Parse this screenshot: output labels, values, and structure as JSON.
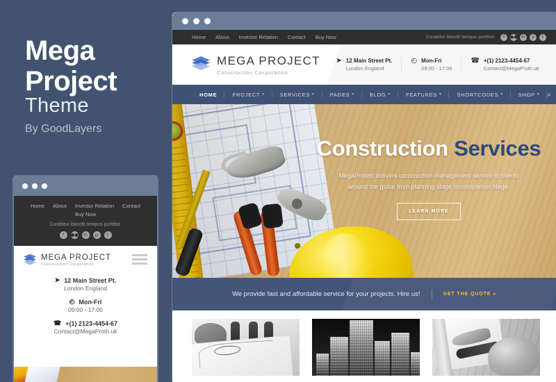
{
  "promo": {
    "title_line1": "Mega",
    "title_line2": "Project",
    "subtitle": "Theme",
    "author": "By GoodLayers"
  },
  "colors": {
    "background": "#41536f",
    "nav_bar": "#3f5175",
    "top_bar": "#2e2e2e",
    "hero_accent": "#2c4a7c",
    "cta_accent": "#f5c51b",
    "title_bar": "#6b7d97"
  },
  "browser": {
    "dots": [
      "dot-1",
      "dot-2",
      "dot-3"
    ]
  },
  "topbar": {
    "links": [
      "Home",
      "About",
      "Investor Relation",
      "Contact",
      "Buy Now"
    ],
    "tagline": "Curabitur blandit tempus porttitor.",
    "social": [
      {
        "name": "facebook-icon",
        "glyph": "f"
      },
      {
        "name": "flickr-icon",
        "glyph": "●●"
      },
      {
        "name": "linkedin-icon",
        "glyph": "in"
      },
      {
        "name": "pinterest-icon",
        "glyph": "p"
      },
      {
        "name": "twitter-icon",
        "glyph": "t"
      }
    ]
  },
  "header": {
    "logo_title": "MEGA PROJECT",
    "logo_subtitle": "Construction Corporation",
    "contacts": [
      {
        "icon": "location-icon",
        "glyph": "➤",
        "line1": "12 Main Street Pt.",
        "line2": "London England"
      },
      {
        "icon": "clock-icon",
        "glyph": "◴",
        "line1": "Mon-Fri",
        "line2": "09:00 - 17:00"
      },
      {
        "icon": "phone-icon",
        "glyph": "☎",
        "line1": "+(1) 2123-4454-67",
        "line2": "Contact@MegaProth.uk"
      }
    ]
  },
  "nav": {
    "items": [
      {
        "label": "HOME",
        "caret": "",
        "active": true
      },
      {
        "label": "PROJECT",
        "caret": "▾",
        "active": false
      },
      {
        "label": "SERVICES",
        "caret": "▾",
        "active": false
      },
      {
        "label": "PAGES",
        "caret": "▾",
        "active": false
      },
      {
        "label": "BLOG",
        "caret": "▾",
        "active": false
      },
      {
        "label": "FEATURES",
        "caret": "▾",
        "active": false
      },
      {
        "label": "SHORTCODES",
        "caret": "▾",
        "active": false
      },
      {
        "label": "SHOP",
        "caret": "▾",
        "active": false
      }
    ],
    "search_glyph": "⌕"
  },
  "hero": {
    "title_main": "Construction ",
    "title_accent": "Services",
    "description": "MegaProject delivers construction management service to clients around the globe from planning stage to completion stage.",
    "button_label": "LEARN MORE"
  },
  "cta": {
    "text": "We provide fast and affordable service for your projects. Hire us!",
    "button_label": "GET THE QUOTE  »"
  },
  "thumbnails": [
    {
      "name": "blueprint-meeting-photo",
      "alt": "Blueprints with glasses and people"
    },
    {
      "name": "city-skyline-photo",
      "alt": "Skyscrapers at night"
    },
    {
      "name": "tools-hardhat-photo",
      "alt": "Tools and hard hat on wood"
    }
  ],
  "mobile": {
    "topbar_links": [
      "Home",
      "About",
      "Investor Relation",
      "Contact",
      "Buy Now"
    ],
    "tagline": "Curabitur blandit tempus porttitor.",
    "social": [
      {
        "name": "facebook-icon",
        "glyph": "f"
      },
      {
        "name": "flickr-icon",
        "glyph": "●●"
      },
      {
        "name": "linkedin-icon",
        "glyph": "in"
      },
      {
        "name": "pinterest-icon",
        "glyph": "p"
      },
      {
        "name": "twitter-icon",
        "glyph": "t"
      }
    ],
    "logo_title": "MEGA PROJECT",
    "logo_subtitle": "Construction Corporation",
    "contacts": [
      {
        "icon": "location-icon",
        "glyph": "➤",
        "line1": "12 Main Street Pt.",
        "line2": "London England"
      },
      {
        "icon": "clock-icon",
        "glyph": "◴",
        "line1": "Mon-Fri",
        "line2": "09:00 - 17:00"
      },
      {
        "icon": "phone-icon",
        "glyph": "☎",
        "line1": "+(1) 2123-4454-67",
        "line2": "Contact@MegaProth.uk"
      }
    ]
  }
}
